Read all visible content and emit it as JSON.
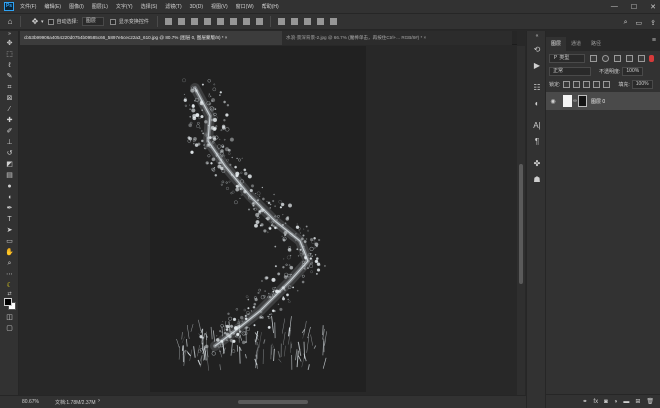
{
  "app": {
    "logo": "Ps"
  },
  "menubar": {
    "items": [
      "文件(F)",
      "编辑(E)",
      "图像(I)",
      "图层(L)",
      "文字(Y)",
      "选择(S)",
      "滤镜(T)",
      "3D(D)",
      "视图(V)",
      "窗口(W)",
      "帮助(H)"
    ]
  },
  "window_controls": {
    "minimize": "—",
    "maximize": "☐",
    "close": "✕"
  },
  "options_bar": {
    "auto_select_label": "自动选择:",
    "auto_select_value": "图层",
    "show_transform_label": "显示变换控件"
  },
  "tabs": [
    {
      "label": "cb53b99906a4054220d0754b09585c66_5897e5cec22a3_610.jpg @ 80.7% (图层 0, 图层蒙版/8) * ×"
    },
    {
      "label": "水浪·景深背景-2.jpg @ 66.7% (魔棒单击，再按住Ctrl+...  RGB/8#) * ×"
    }
  ],
  "status": {
    "zoom": "80.67%",
    "doc": "文档:1.78M/2.37M"
  },
  "panel": {
    "tabs": [
      "图层",
      "通道",
      "路径"
    ],
    "filter_kind": "Ｐ 类型",
    "blend_mode": "正常",
    "opacity_label": "不透明度:",
    "opacity_value": "100%",
    "lock_label": "锁定:",
    "fill_label": "填充:",
    "fill_value": "100%",
    "layer": {
      "name": "图层 0",
      "eye_icon": "eye-icon"
    }
  },
  "colors": {
    "accent": "#31a8ff",
    "selected_layer": "#4a4a4a",
    "canvas_bg": "#212121"
  }
}
